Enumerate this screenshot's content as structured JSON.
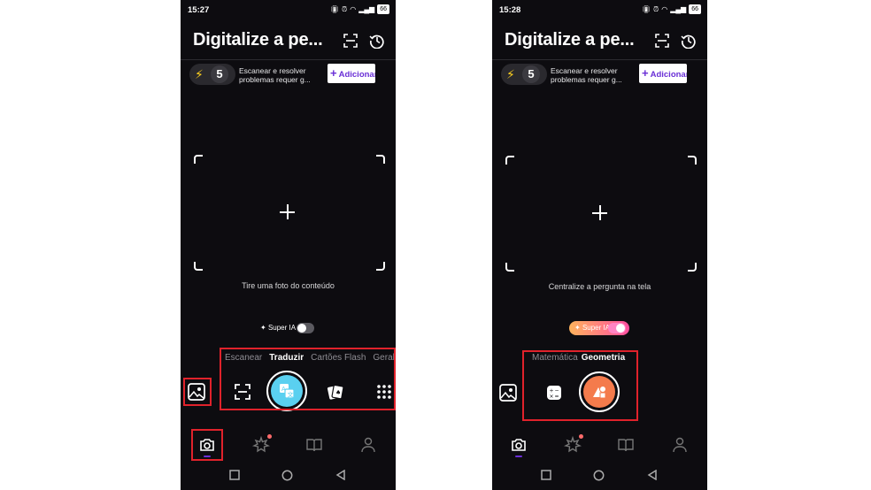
{
  "left": {
    "status": {
      "time": "15:27",
      "battery": "66"
    },
    "header": {
      "title": "Digitalize a pe..."
    },
    "credits": {
      "count": "5"
    },
    "promo": {
      "line1": "Escanear e resolver",
      "line2": "problemas requer g..."
    },
    "add_button": {
      "label": "Adicionar"
    },
    "hint": "Tire uma foto do conteúdo",
    "super_ia": {
      "label": "Super IA",
      "enabled": false
    },
    "modes": [
      "Escanear",
      "Traduzir",
      "Cartões Flash",
      "Geral"
    ],
    "active_mode": "Traduzir"
  },
  "right": {
    "status": {
      "time": "15:28",
      "battery": "66"
    },
    "header": {
      "title": "Digitalize a pe..."
    },
    "credits": {
      "count": "5"
    },
    "promo": {
      "line1": "Escanear e resolver",
      "line2": "problemas requer g..."
    },
    "add_button": {
      "label": "Adicionar"
    },
    "hint": "Centralize a pergunta na tela",
    "super_ia": {
      "label": "Super IA",
      "enabled": true
    },
    "modes": [
      "Matemática",
      "Geometria"
    ],
    "active_mode": "Geometria"
  },
  "colors": {
    "background": "#0d0c10",
    "translate_shutter": "#5ad0f0",
    "geometry_shutter": "#f47b4c",
    "accent_purple": "#6a2fd6",
    "highlight_red": "#e0222b",
    "notification_dot": "#ff6b6b",
    "super_ia_gradient_start": "#ffb35c",
    "super_ia_gradient_end": "#ff4fa0"
  },
  "icons": {
    "header": [
      "scan-icon",
      "history-icon"
    ],
    "left_tools": [
      "gallery-icon",
      "scan-frame-icon",
      "translate-icon",
      "flashcards-icon",
      "grid-icon"
    ],
    "right_tools": [
      "gallery-icon",
      "calculator-icon",
      "geometry-icon"
    ],
    "bottom_nav": [
      "camera-icon",
      "ai-sparkle-icon",
      "book-icon",
      "profile-icon"
    ],
    "system_nav": [
      "recents-square-icon",
      "home-circle-icon",
      "back-triangle-icon"
    ]
  }
}
